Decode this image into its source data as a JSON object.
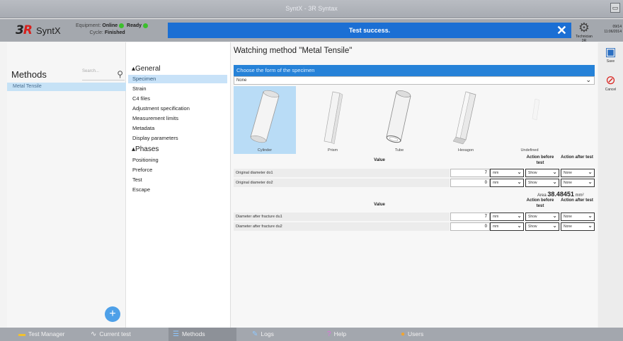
{
  "window": {
    "title": "SyntX - 3R Syntax",
    "max_icon": "maximize-icon"
  },
  "header": {
    "brand": "SyntX",
    "equipment_label": "Equipment:",
    "equipment_value": "Online",
    "ready": "Ready",
    "cycle_label": "Cycle:",
    "cycle_value": "Finished",
    "banner_text": "Test success.",
    "technician": "Technician 3R",
    "date": "09/14",
    "time": "11:06/2014"
  },
  "left": {
    "title": "Methods",
    "search_placeholder": "Search...",
    "items": [
      "Metal Tensile"
    ]
  },
  "nav": {
    "general_heading": "General",
    "general_items": [
      "Specimen",
      "Strain",
      "C4 files",
      "Adjustment specification",
      "Measurement limits",
      "Metadata",
      "Display parameters"
    ],
    "phases_heading": "Phases",
    "phase_items": [
      "Positioning",
      "Preforce",
      "Test",
      "Escape"
    ],
    "selected": "Specimen"
  },
  "main": {
    "title": "Watching method \"Metal Tensile\"",
    "section_title": "Choose the form of the specimen",
    "select_value": "None",
    "shapes": [
      "Cylinder",
      "Prism",
      "Tube",
      "Hexagon",
      "Undefined"
    ],
    "selected_shape": "Cylinder",
    "value_header": "Value",
    "action_before": "Action before test",
    "action_after": "Action after test",
    "rows1": [
      {
        "label": "Original diameter do1",
        "value": "7",
        "unit": "mm",
        "before": "Show",
        "after": "None"
      },
      {
        "label": "Original diameter do2",
        "value": "0",
        "unit": "mm",
        "before": "Show",
        "after": "None"
      }
    ],
    "area_label": "Area",
    "area_value": "38.48451",
    "area_unit": "mm²",
    "rows2": [
      {
        "label": "Diameter after fracture du1",
        "value": "7",
        "unit": "mm",
        "before": "Show",
        "after": "None"
      },
      {
        "label": "Diameter after fracture du2",
        "value": "0",
        "unit": "mm",
        "before": "Show",
        "after": "None"
      }
    ]
  },
  "actions": {
    "save": "Save",
    "cancel": "Cancel"
  },
  "bottom_tabs": [
    {
      "label": "Test Manager",
      "icon": "folder-icon"
    },
    {
      "label": "Current test",
      "icon": "chart-icon"
    },
    {
      "label": "Methods",
      "icon": "list-icon"
    },
    {
      "label": "Logs",
      "icon": "log-icon"
    },
    {
      "label": "Help",
      "icon": "help-icon"
    },
    {
      "label": "Users",
      "icon": "users-icon"
    }
  ],
  "colors": {
    "accent": "#1b6fd4",
    "selection": "#c8e2f8",
    "ok": "#3bbf2c",
    "cancel": "#d9201c"
  }
}
